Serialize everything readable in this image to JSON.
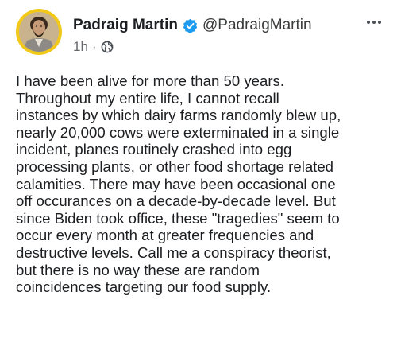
{
  "post": {
    "author": {
      "name": "Padraig Martin",
      "handle": "@PadraigMartin",
      "verified": true
    },
    "meta": {
      "time": "1h",
      "separator": "·",
      "privacy_icon": "public-globe-icon"
    },
    "more_icon": "more-options-icon",
    "text_lines": [
      "I have been alive for more than 50 years.",
      "Throughout my entire life, I cannot recall",
      "instances by which dairy farms randomly blew up,",
      "nearly 20,000 cows were exterminated in a single",
      "incident, planes routinely crashed into egg",
      "processing plants, or other food shortage related",
      "calamities. There may have been occasional one",
      "off occurances on a decade-by-decade level. But",
      "since Biden took office, these \"tragedies\" seem to",
      "occur every month at greater frequencies and",
      "destructive levels. Call me a conspiracy theorist,",
      "but there is no way these are random",
      "coincidences targeting our food supply."
    ]
  },
  "colors": {
    "avatar_ring": "#f2c919",
    "verified_badge": "#1d9bf0",
    "text": "#1c1e21",
    "meta": "#65676b"
  }
}
